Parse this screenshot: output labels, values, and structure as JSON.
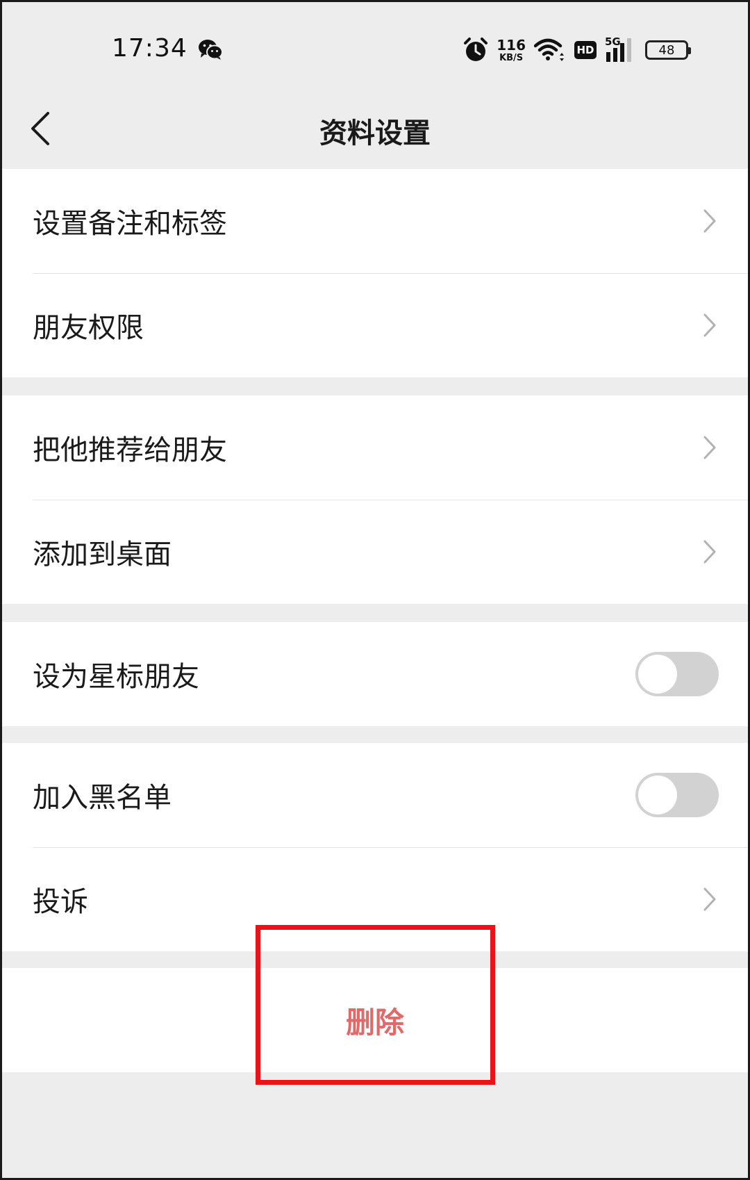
{
  "status_bar": {
    "time": "17:34",
    "net_speed_value": "116",
    "net_speed_unit": "KB/S",
    "hd_label": "HD",
    "signal_label": "5G",
    "battery_level": "48",
    "icons": [
      "wechat-icon",
      "alarm-icon",
      "wifi-icon",
      "signal-icon",
      "battery-icon"
    ]
  },
  "nav": {
    "title": "资料设置",
    "back_icon": "chevron-left-icon"
  },
  "groups": [
    {
      "rows": [
        {
          "label": "设置备注和标签",
          "control": "chevron"
        },
        {
          "label": "朋友权限",
          "control": "chevron"
        }
      ]
    },
    {
      "rows": [
        {
          "label": "把他推荐给朋友",
          "control": "chevron"
        },
        {
          "label": "添加到桌面",
          "control": "chevron"
        }
      ]
    },
    {
      "rows": [
        {
          "label": "设为星标朋友",
          "control": "toggle",
          "on": false
        }
      ]
    },
    {
      "rows": [
        {
          "label": "加入黑名单",
          "control": "toggle",
          "on": false
        },
        {
          "label": "投诉",
          "control": "chevron"
        }
      ]
    }
  ],
  "delete": {
    "label": "删除"
  },
  "colors": {
    "background": "#ededed",
    "card": "#ffffff",
    "delete_text": "#e06a6a",
    "highlight_border": "#e8141a",
    "toggle_off": "#d2d2d2"
  }
}
